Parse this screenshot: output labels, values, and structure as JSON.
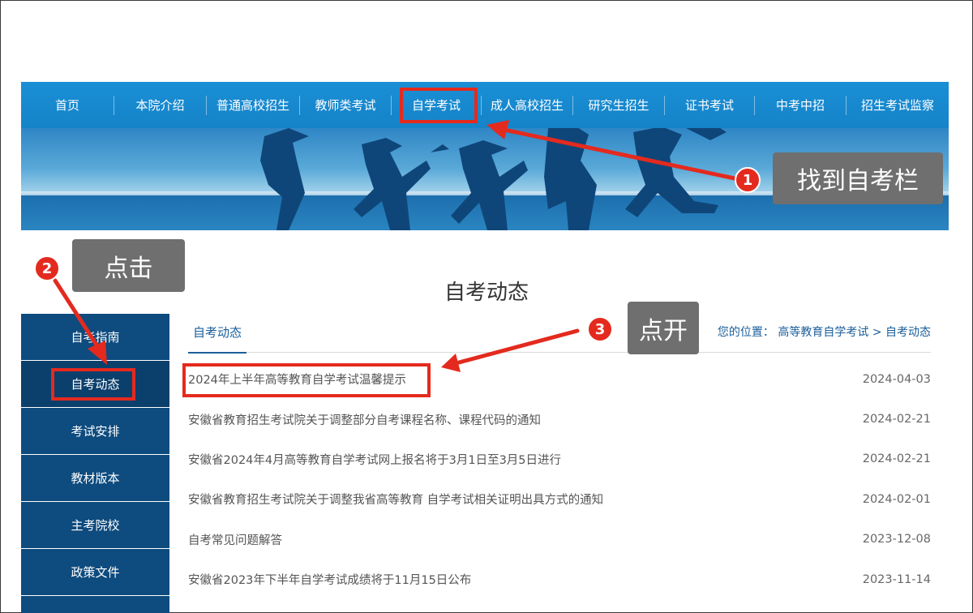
{
  "nav": {
    "items": [
      "首页",
      "本院介绍",
      "普通高校招生",
      "教师类考试",
      "自学考试",
      "成人高校招生",
      "研究生招生",
      "证书考试",
      "中考中招",
      "招生考试监察"
    ]
  },
  "page_title": "自考动态",
  "sidebar": {
    "items": [
      "自考指南",
      "自考动态",
      "考试安排",
      "教材版本",
      "主考院校",
      "政策文件"
    ]
  },
  "tab": {
    "label": "自考动态"
  },
  "breadcrumb": {
    "prefix": "您的位置：",
    "level1": "高等教育自学考试",
    "separator": ">",
    "level2": "自考动态"
  },
  "news": [
    {
      "title": "2024年上半年高等教育自学考试温馨提示",
      "date": "2024-04-03"
    },
    {
      "title": "安徽省教育招生考试院关于调整部分自考课程名称、课程代码的通知",
      "date": "2024-02-21"
    },
    {
      "title": "安徽省2024年4月高等教育自学考试网上报名将于3月1日至3月5日进行",
      "date": "2024-02-21"
    },
    {
      "title": "安徽省教育招生考试院关于调整我省高等教育 自学考试相关证明出具方式的通知",
      "date": "2024-02-01"
    },
    {
      "title": "自考常见问题解答",
      "date": "2023-12-08"
    },
    {
      "title": "安徽省2023年下半年自学考试成绩将于11月15日公布",
      "date": "2023-11-14"
    }
  ],
  "annotations": {
    "step1": {
      "number": "1",
      "text": "找到自考栏"
    },
    "step2": {
      "number": "2",
      "text": "点击"
    },
    "step3": {
      "number": "3",
      "text": "点开"
    }
  },
  "colors": {
    "nav_bg": "#1583c8",
    "sidebar_bg": "#0e4b7e",
    "highlight": "#e42a1e",
    "callout_bg": "#6f6f6f",
    "link": "#1b5e9a"
  }
}
